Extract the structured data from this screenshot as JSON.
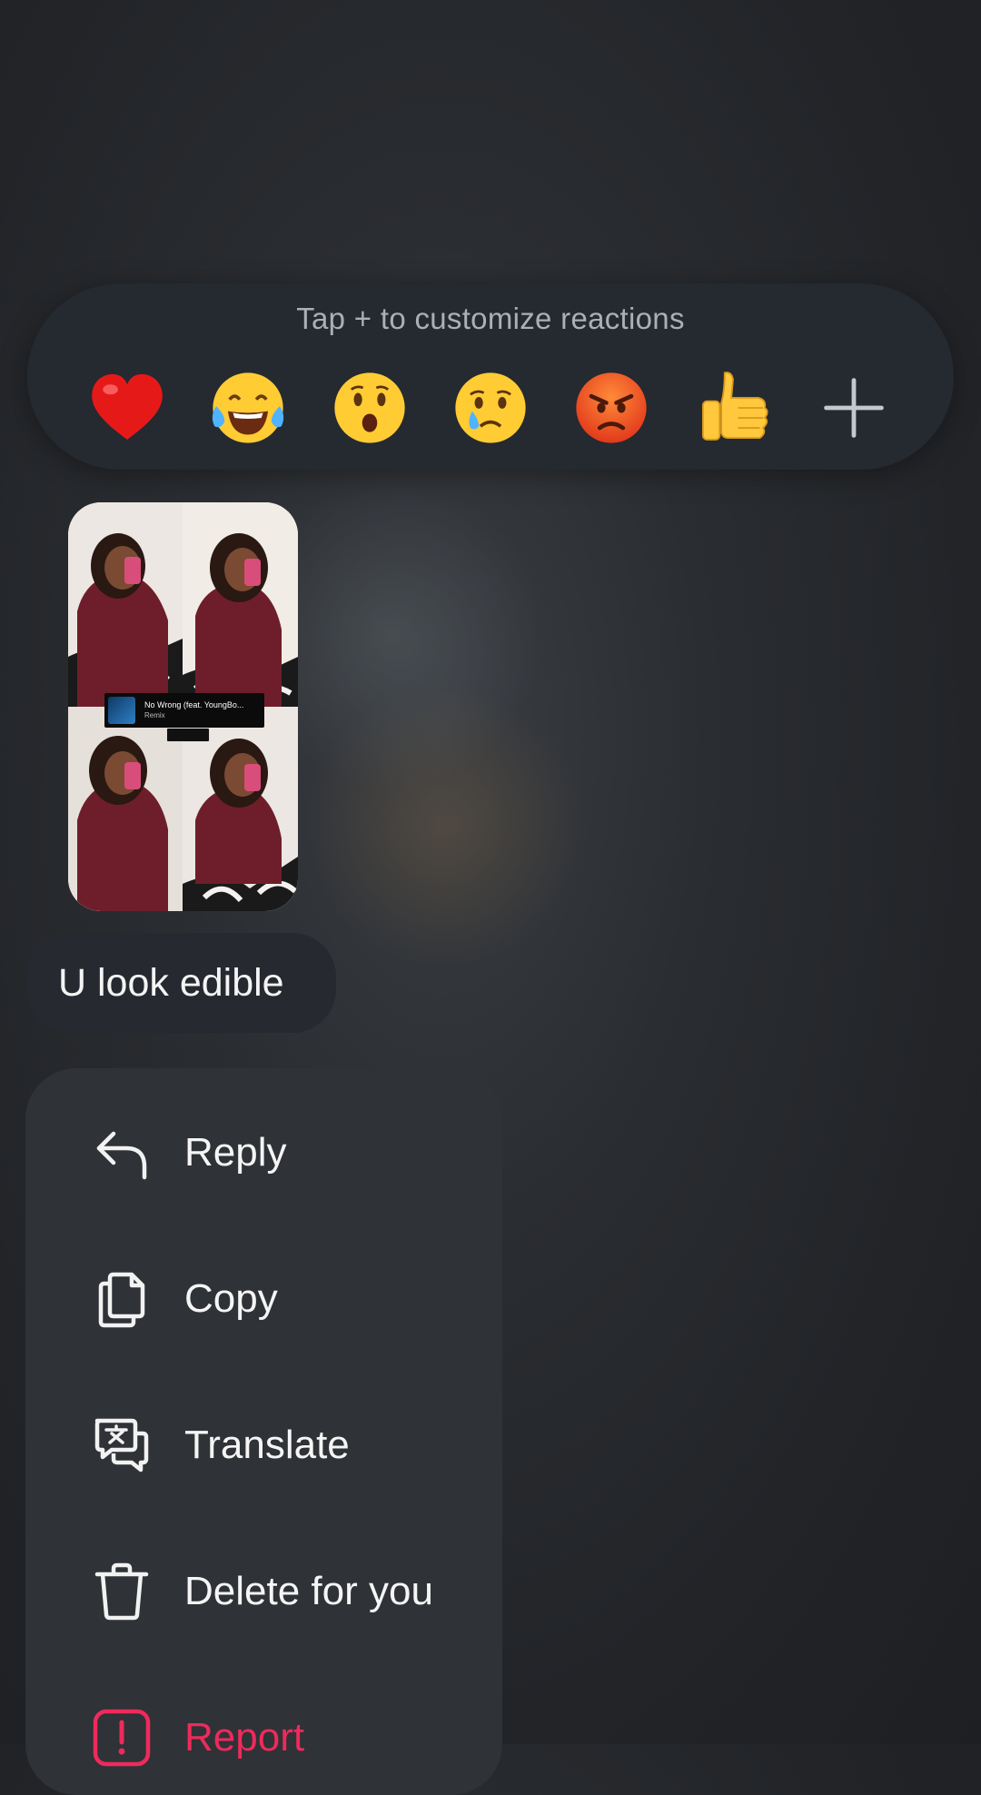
{
  "reactions": {
    "hint": "Tap + to customize reactions",
    "items": [
      {
        "name": "red-heart",
        "label": "❤"
      },
      {
        "name": "face-with-tears-of-joy",
        "label": "😂"
      },
      {
        "name": "face-with-open-mouth",
        "label": "😮"
      },
      {
        "name": "crying-face",
        "label": "😢"
      },
      {
        "name": "pouting-face",
        "label": "😡"
      },
      {
        "name": "thumbs-up",
        "label": "👍"
      }
    ],
    "add_icon": "plus-icon"
  },
  "shared_post": {
    "music": {
      "title": "No Wrong (feat. YoungBo...",
      "artist": "Remix"
    }
  },
  "message": {
    "text": "U look edible"
  },
  "menu": {
    "items": [
      {
        "label": "Reply",
        "icon": "reply-icon"
      },
      {
        "label": "Copy",
        "icon": "copy-icon"
      },
      {
        "label": "Translate",
        "icon": "translate-icon"
      },
      {
        "label": "Delete for you",
        "icon": "trash-icon"
      },
      {
        "label": "Report",
        "icon": "report-icon",
        "color": "#ee2a5c"
      }
    ]
  },
  "colors": {
    "background": "#222428",
    "menu_background": "#2f3236",
    "danger": "#ee2a5c"
  }
}
